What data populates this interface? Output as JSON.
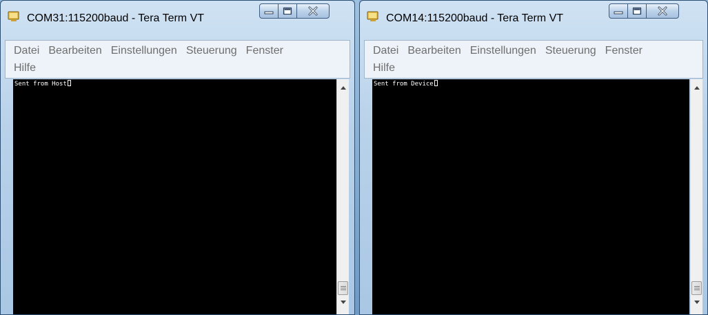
{
  "windows": [
    {
      "title": "COM31:115200baud - Tera Term VT",
      "menu": [
        "Datei",
        "Bearbeiten",
        "Einstellungen",
        "Steuerung",
        "Fenster",
        "Hilfe"
      ],
      "terminal_text": "Sent from Host"
    },
    {
      "title": "COM14:115200baud - Tera Term VT",
      "menu": [
        "Datei",
        "Bearbeiten",
        "Einstellungen",
        "Steuerung",
        "Fenster",
        "Hilfe"
      ],
      "terminal_text": "Sent from Device"
    }
  ],
  "controls": {
    "minimize_icon": "minimize-icon",
    "maximize_icon": "maximize-icon",
    "close_icon": "close-icon"
  },
  "colors": {
    "terminal_bg": "#000000",
    "terminal_fg": "#ffffff",
    "menu_text": "#6e6e6e",
    "title_text": "#000000"
  }
}
